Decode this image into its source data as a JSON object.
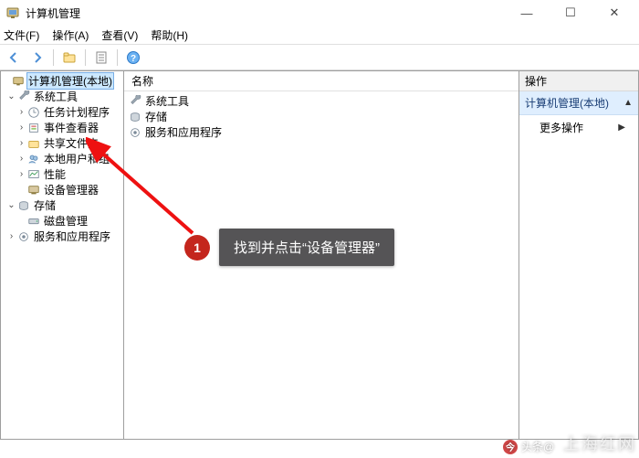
{
  "titlebar": {
    "title": "计算机管理"
  },
  "menubar": {
    "file": "文件(F)",
    "action": "操作(A)",
    "view": "查看(V)",
    "help": "帮助(H)"
  },
  "tree": {
    "root": "计算机管理(本地)",
    "sys_tools": "系统工具",
    "task_sched": "任务计划程序",
    "event_vwr": "事件查看器",
    "shared": "共享文件夹",
    "local_users": "本地用户和组",
    "perf": "性能",
    "dev_mgr": "设备管理器",
    "storage": "存储",
    "disk_mgmt": "磁盘管理",
    "svc_apps": "服务和应用程序"
  },
  "list": {
    "header": "名称",
    "items": [
      "系统工具",
      "存储",
      "服务和应用程序"
    ]
  },
  "actions": {
    "header": "操作",
    "section": "计算机管理(本地)",
    "more": "更多操作"
  },
  "callout": {
    "num": "1",
    "text": "找到并点击“设备管理器”"
  },
  "watermark": {
    "left_prefix": "头条@",
    "right": "上海红网"
  }
}
